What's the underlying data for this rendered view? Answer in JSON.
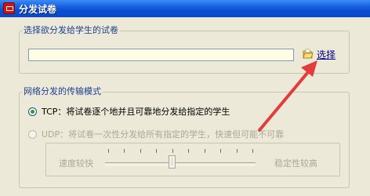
{
  "window": {
    "title": "分发试卷",
    "app_icon": "app-icon"
  },
  "file_group": {
    "label": "选择欲分发给学生的试卷",
    "input_value": "",
    "pick_button": {
      "label": "选择",
      "icon": "folder-open-icon"
    }
  },
  "mode_group": {
    "label": "网络分发的传输模式",
    "options": [
      {
        "label": "TCP：将试卷逐个地并且可靠地分发给指定的学生",
        "selected": true,
        "enabled": true
      },
      {
        "label": "UDP：将试卷一次性分发给所有指定的学生，快速但可能不可靠",
        "selected": false,
        "enabled": false
      }
    ],
    "slider": {
      "left_label": "速度较快",
      "right_label": "稳定性较高",
      "tick_count": 10,
      "value_fraction": 0.44,
      "enabled": false
    }
  },
  "colors": {
    "titlebar": "#0b55e0",
    "dialog_bg": "#ece9d8",
    "input_bg": "#fffde4",
    "annotation_arrow": "#e23c3c"
  }
}
